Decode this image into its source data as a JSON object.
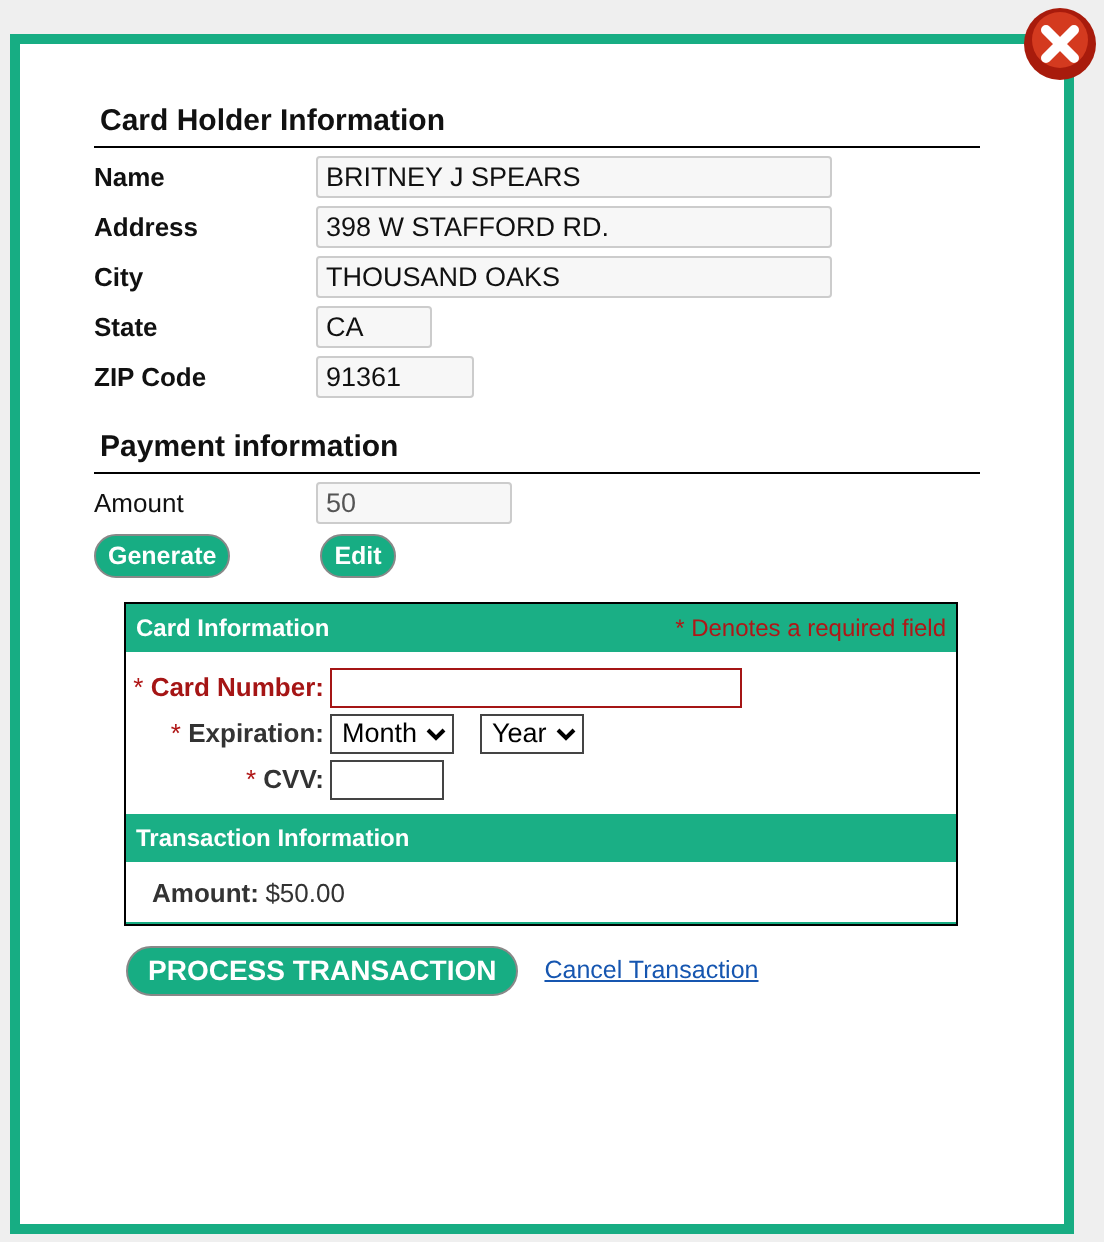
{
  "holder": {
    "title": "Card Holder Information",
    "fields": [
      {
        "label": "Name",
        "value": "BRITNEY J SPEARS"
      },
      {
        "label": "Address",
        "value": "398 W STAFFORD RD."
      },
      {
        "label": "City",
        "value": "THOUSAND OAKS"
      },
      {
        "label": "State",
        "value": "CA"
      },
      {
        "label": "ZIP Code",
        "value": "91361"
      }
    ]
  },
  "payment": {
    "title": "Payment information",
    "amount_label": "Amount",
    "amount_value": "50",
    "buttons": [
      "Generate",
      "Edit"
    ]
  },
  "card": {
    "title": "Card Information",
    "required_note": "* Denotes a required field",
    "fields": [
      {
        "kind": "text",
        "marker": "*",
        "label": "Card Number:",
        "error": true
      },
      {
        "kind": "selects",
        "marker": "*",
        "label": "Expiration:",
        "error": false,
        "options": [
          "Month",
          "Year"
        ]
      },
      {
        "kind": "text",
        "marker": "*",
        "label": "CVV:",
        "error": false
      }
    ]
  },
  "transaction": {
    "title": "Transaction Information",
    "amount_label": "Amount:",
    "amount_value": "$50.00"
  },
  "actions": {
    "process": "PROCESS TRANSACTION",
    "cancel": "Cancel Transaction"
  }
}
